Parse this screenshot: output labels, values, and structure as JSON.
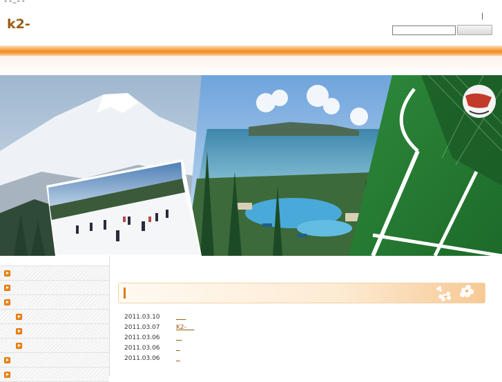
{
  "header": {
    "tagline": "\" \"~\"  \"",
    "logo": "k2-",
    "top_mark": "|",
    "search": {
      "value": "",
      "placeholder": "",
      "button_label": ""
    }
  },
  "sidebar": {
    "items": [
      {
        "label": "",
        "level": 1,
        "icon": "orange-arrow-bullet-icon"
      },
      {
        "label": "",
        "level": 1,
        "icon": "orange-arrow-bullet-icon"
      },
      {
        "label": "",
        "level": 1,
        "icon": "orange-arrow-bullet-icon"
      },
      {
        "label": "",
        "level": 2,
        "icon": "orange-arrow-bullet-icon"
      },
      {
        "label": "",
        "level": 2,
        "icon": "orange-arrow-bullet-icon"
      },
      {
        "label": "",
        "level": 2,
        "icon": "orange-arrow-bullet-icon"
      },
      {
        "label": "",
        "level": 1,
        "icon": "orange-arrow-bullet-icon"
      },
      {
        "label": "",
        "level": 1,
        "icon": "orange-arrow-bullet-icon"
      }
    ]
  },
  "main": {
    "heading": "",
    "news": [
      {
        "date": "2011.03.10",
        "title": "     "
      },
      {
        "date": "2011.03.07",
        "title": "K2-    "
      },
      {
        "date": "2011.03.06",
        "title": "   "
      },
      {
        "date": "2011.03.06",
        "title": "  "
      },
      {
        "date": "2011.03.06",
        "title": "  "
      }
    ]
  },
  "colors": {
    "accent": "#f08a1e",
    "link": "#9a5c12",
    "logo": "#9a5c12"
  }
}
